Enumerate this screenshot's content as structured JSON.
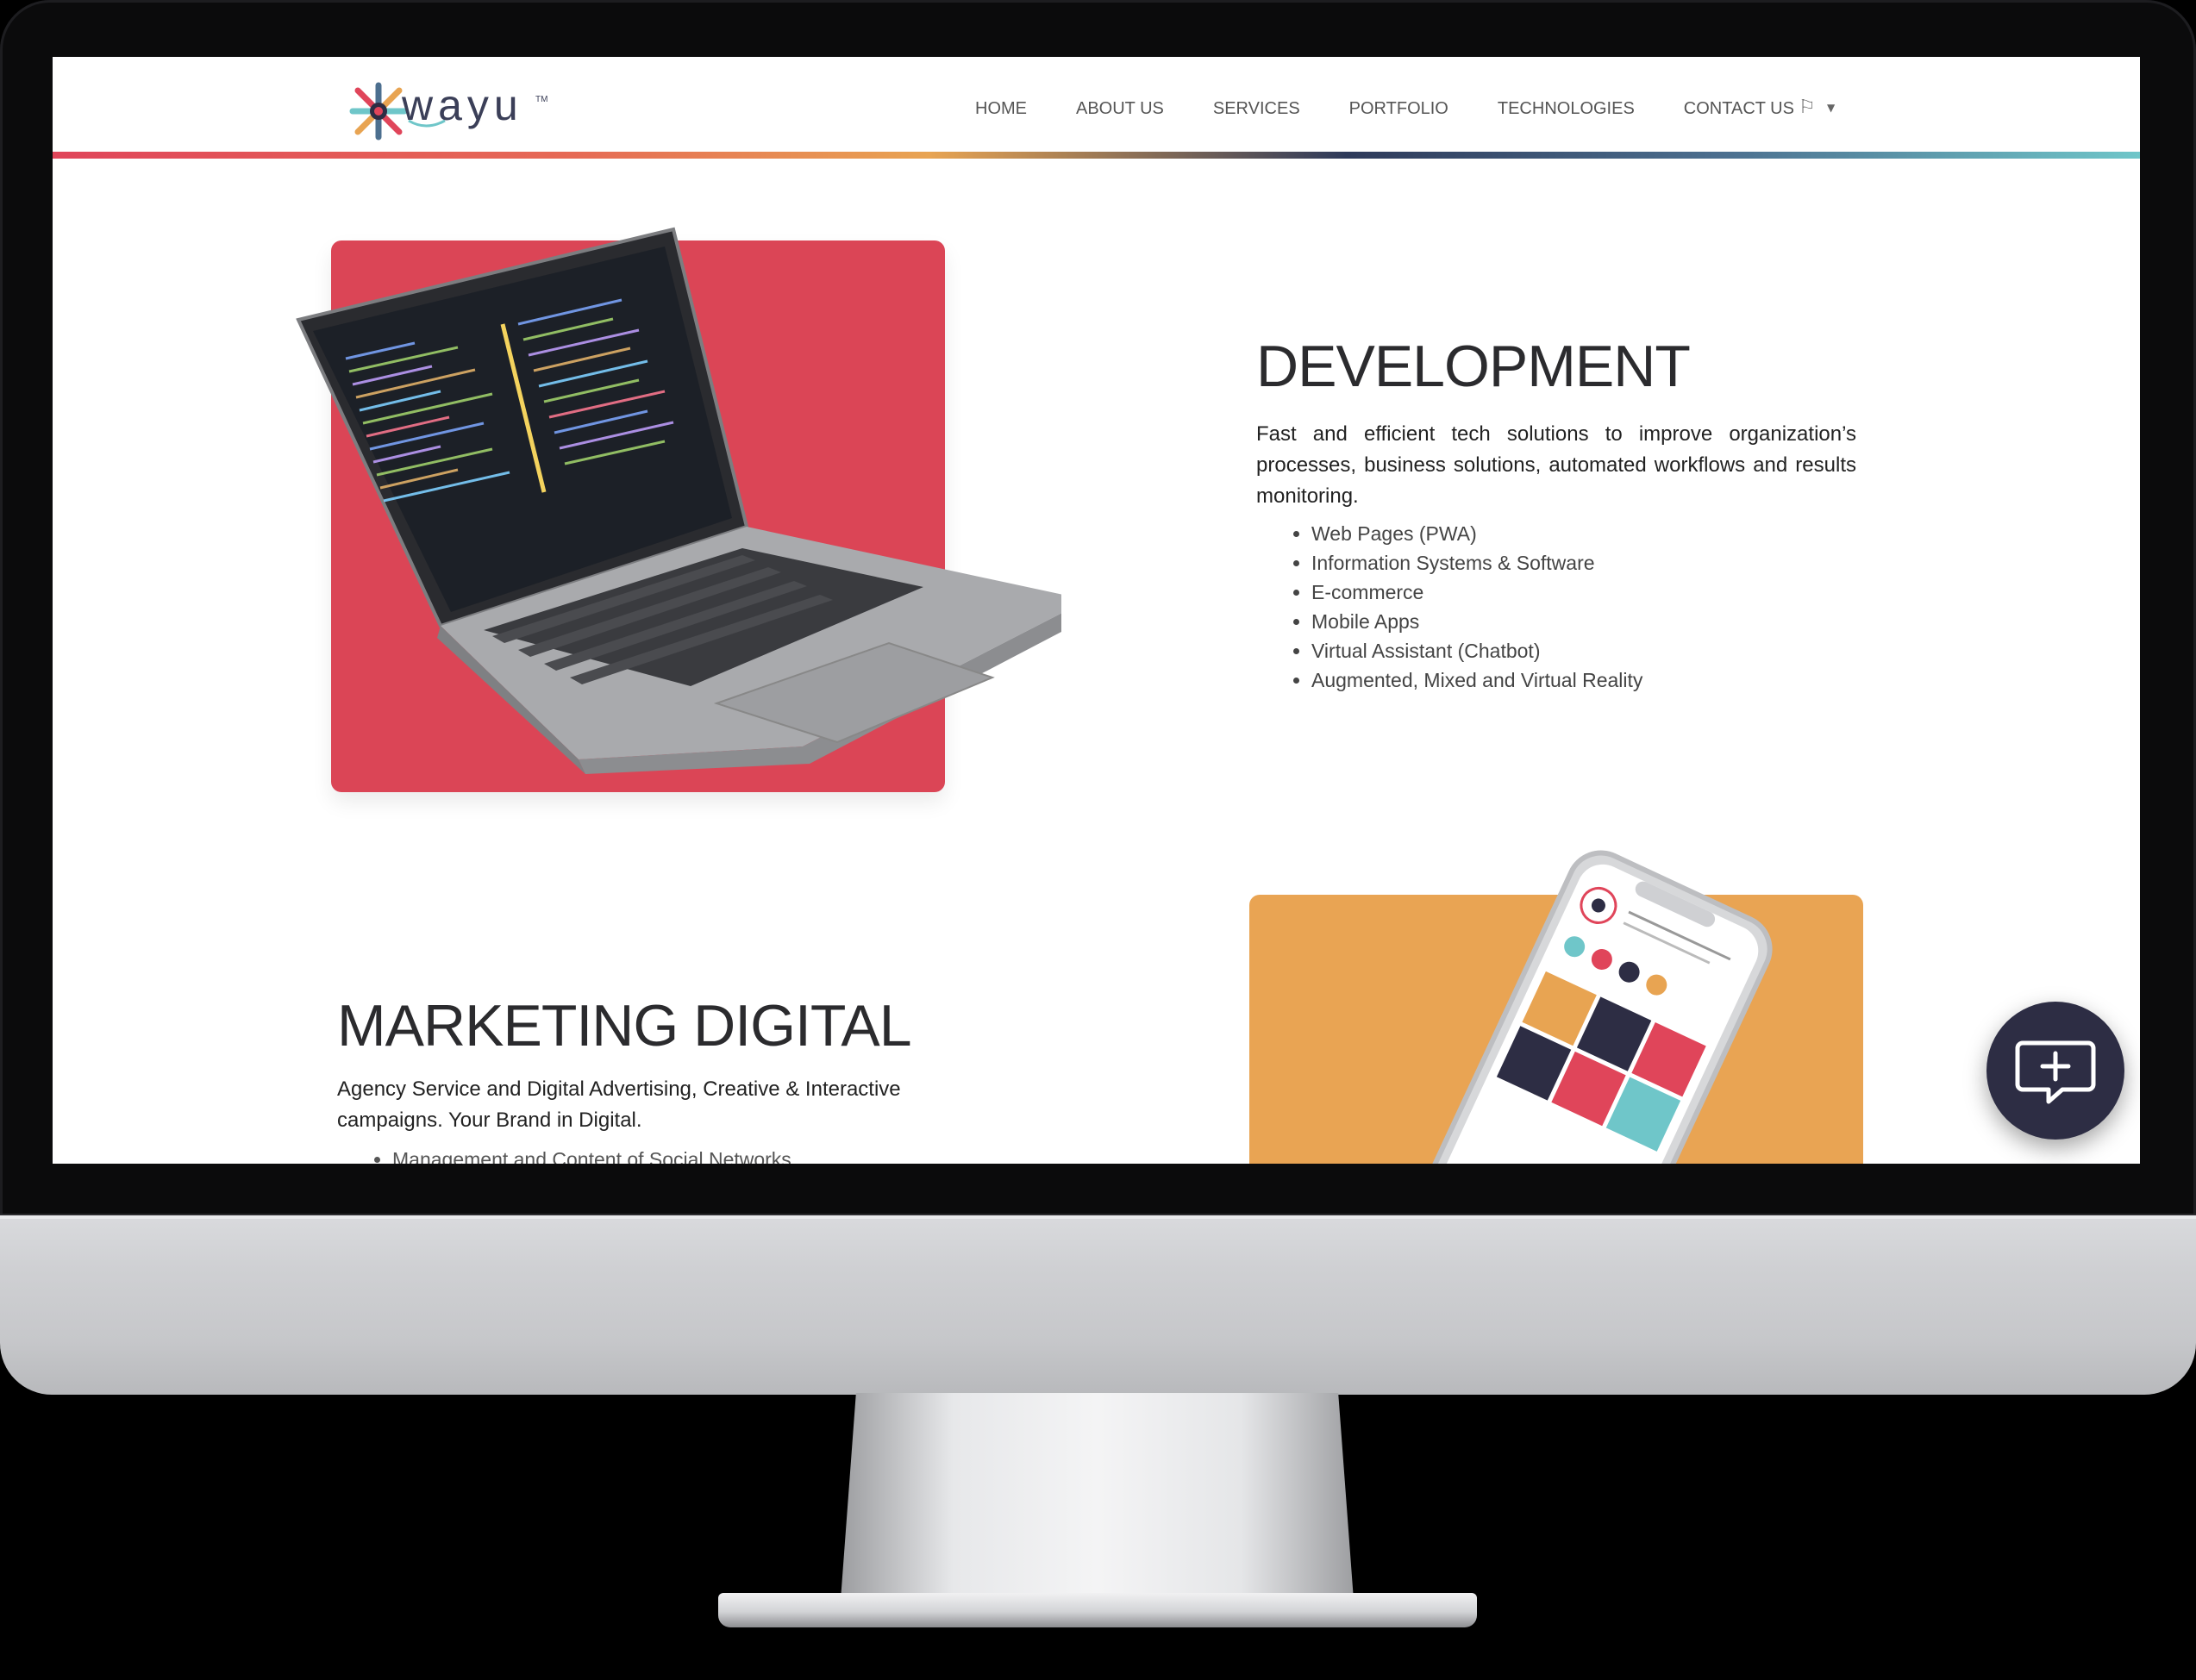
{
  "brand": {
    "name": "wayu",
    "tm": "TM"
  },
  "nav": {
    "items": [
      "HOME",
      "ABOUT US",
      "SERVICES",
      "PORTFOLIO",
      "TECHNOLOGIES",
      "CONTACT US"
    ],
    "language_icon": "flag-icon"
  },
  "development": {
    "title": "DEVELOPMENT",
    "description": "Fast and efficient tech solutions to improve organization’s processes, business solutions, automated workflows and results monitoring.",
    "items": [
      "Web Pages (PWA)",
      "Information Systems & Software",
      "E-commerce",
      "Mobile Apps",
      "Virtual Assistant (Chatbot)",
      "Augmented, Mixed and Virtual Reality"
    ],
    "card_color": "#db4556"
  },
  "marketing": {
    "title": "MARKETING DIGITAL",
    "description": "Agency Service and Digital Advertising, Creative & Interactive campaigns. Your Brand in Digital.",
    "items": [
      "Management and Content of Social Networks"
    ],
    "card_color": "#e9a453"
  },
  "chat": {
    "icon": "chat-plus-icon"
  },
  "colors": {
    "accent_red": "#db4556",
    "accent_orange": "#e9a453",
    "dark": "#2d2d44"
  }
}
